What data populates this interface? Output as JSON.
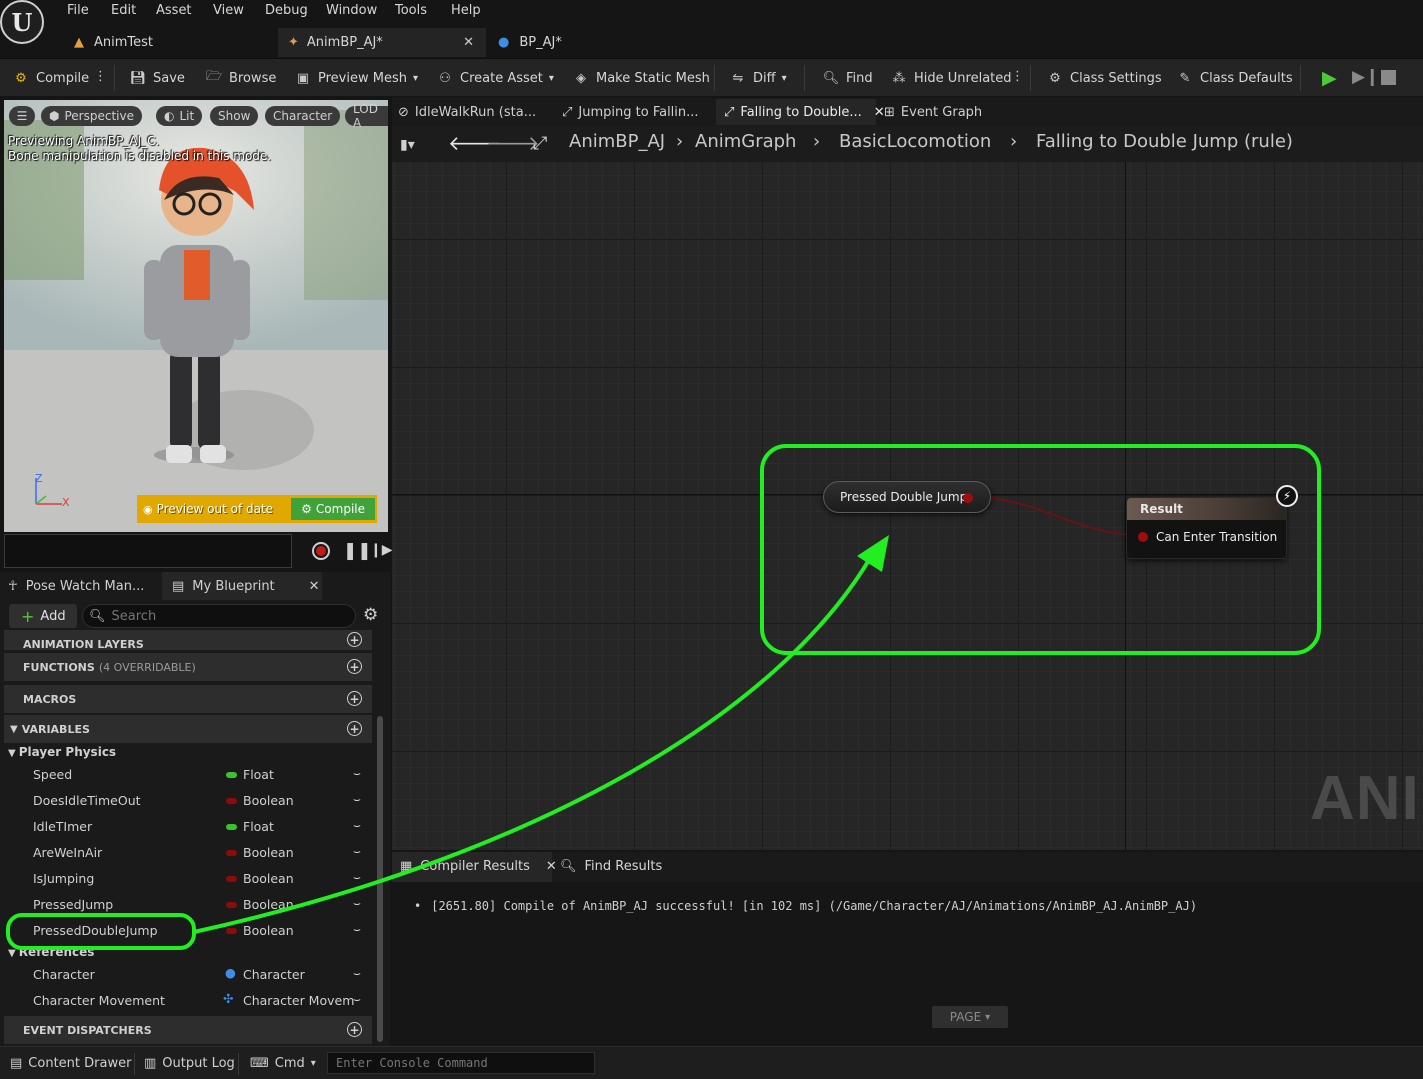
{
  "menu": [
    "File",
    "Edit",
    "Asset",
    "View",
    "Debug",
    "Window",
    "Tools",
    "Help"
  ],
  "doc_tabs": [
    {
      "label": "AnimTest",
      "icon": "level-icon"
    },
    {
      "label": "AnimBP_AJ*",
      "icon": "anim-blueprint-icon"
    },
    {
      "label": "BP_AJ*",
      "icon": "character-blueprint-icon"
    }
  ],
  "toolbar": {
    "compile": "Compile",
    "save": "Save",
    "browse": "Browse",
    "preview_mesh": "Preview Mesh",
    "create_asset": "Create Asset",
    "make_static_mesh": "Make Static Mesh",
    "diff": "Diff",
    "find": "Find",
    "hide_unrelated": "Hide Unrelated",
    "class_settings": "Class Settings",
    "class_defaults": "Class Defaults"
  },
  "viewport": {
    "perspective": "Perspective",
    "lit": "Lit",
    "show": "Show",
    "character": "Character",
    "lod": "LOD A",
    "preview_line1": "Previewing AnimBP_AJ_C.",
    "preview_line2": "Bone manipulation is disabled in this mode.",
    "axis_z": "Z",
    "axis_x": "X",
    "out_of_date": "Preview out of date",
    "compile_btn": "Compile"
  },
  "graph_tabs": [
    {
      "label": "IdleWalkRun (sta..."
    },
    {
      "label": "Jumping to Fallin..."
    },
    {
      "label": "Falling to Double..."
    },
    {
      "label": "Event Graph"
    }
  ],
  "breadcrumb": [
    "AnimBP_AJ",
    "AnimGraph",
    "BasicLocomotion",
    "Falling to Double Jump (rule)"
  ],
  "nodes": {
    "getter": "Pressed Double Jump",
    "result_title": "Result",
    "result_pin": "Can Enter Transition"
  },
  "watermark": "ANIM",
  "panel_tabs": [
    "Pose Watch Man...",
    "My Blueprint"
  ],
  "my_blueprint": {
    "add": "Add",
    "search_placeholder": "Search",
    "anim_layers": "ANIMATION LAYERS",
    "functions": "FUNCTIONS",
    "functions_note": "(4 OVERRIDABLE)",
    "macros": "MACROS",
    "variables": "VARIABLES",
    "cat_physics": "Player Physics",
    "cat_references": "References",
    "event_dispatchers": "EVENT DISPATCHERS",
    "vars": [
      {
        "name": "Speed",
        "type": "Float",
        "color": "#39c234"
      },
      {
        "name": "DoesIdleTimeOut",
        "type": "Boolean",
        "color": "#8c0b0b"
      },
      {
        "name": "IdleTImer",
        "type": "Float",
        "color": "#39c234"
      },
      {
        "name": "AreWeInAir",
        "type": "Boolean",
        "color": "#8c0b0b"
      },
      {
        "name": "IsJumping",
        "type": "Boolean",
        "color": "#8c0b0b"
      },
      {
        "name": "PressedJump",
        "type": "Boolean",
        "color": "#8c0b0b"
      },
      {
        "name": "PressedDoubleJump",
        "type": "Boolean",
        "color": "#8c0b0b"
      }
    ],
    "refs": [
      {
        "name": "Character",
        "type": "Character"
      },
      {
        "name": "Character Movement",
        "type": "Character Movem"
      }
    ]
  },
  "compiler": {
    "tab1": "Compiler Results",
    "tab2": "Find Results",
    "message": "[2651.80] Compile of AnimBP_AJ successful! [in 102 ms] (/Game/Character/AJ/Animations/AnimBP_AJ.AnimBP_AJ)",
    "page": "PAGE"
  },
  "statusbar": {
    "content_drawer": "Content Drawer",
    "output_log": "Output Log",
    "cmd": "Cmd",
    "console_placeholder": "Enter Console Command"
  },
  "colors": {
    "highlight": "#22ee22",
    "bool_pin": "#8c0b0b",
    "float_pin": "#39c234",
    "accent_yellow": "#e0a800"
  }
}
